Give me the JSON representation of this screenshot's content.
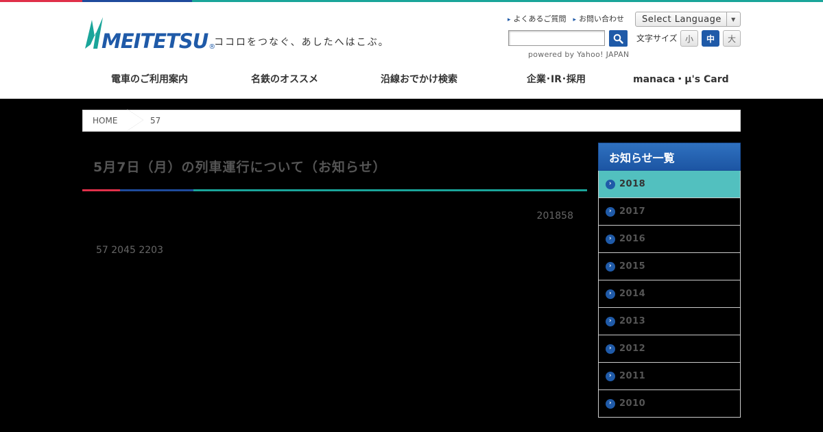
{
  "brand": {
    "logo_text": "MEITETSU",
    "logo_mark": "®",
    "tagline": "ココロをつなぐ、あしたへはこぶ。",
    "colors": {
      "blue": "#1f5aa8",
      "teal": "#1aa59a",
      "red": "#e0304a",
      "active": "#52c0bf"
    }
  },
  "utility": {
    "faq": "よくあるご質問",
    "contact": "お問い合わせ",
    "language": "Select Language",
    "search_value": "",
    "powered_by": "powered by Yahoo! JAPAN",
    "fontsize_label": "文字サイズ",
    "fontsize_small": "小",
    "fontsize_medium": "中",
    "fontsize_large": "大",
    "fontsize_selected": "中"
  },
  "gnav": [
    {
      "label": "電車のご利用案内"
    },
    {
      "label": "名鉄のオススメ"
    },
    {
      "label": "沿線おでかけ検索"
    },
    {
      "label": "企業･IR･採用"
    },
    {
      "label": "manaca・μ's Card"
    }
  ],
  "breadcrumb": {
    "home": "HOME",
    "current": "57"
  },
  "article": {
    "title": "5月7日（月）の列車運行について（お知らせ）",
    "date": "201858",
    "body": "57 2045 2203"
  },
  "sidebar": {
    "heading": "お知らせ一覧",
    "items": [
      "2018",
      "2017",
      "2016",
      "2015",
      "2014",
      "2013",
      "2012",
      "2011",
      "2010"
    ],
    "active": "2018"
  }
}
